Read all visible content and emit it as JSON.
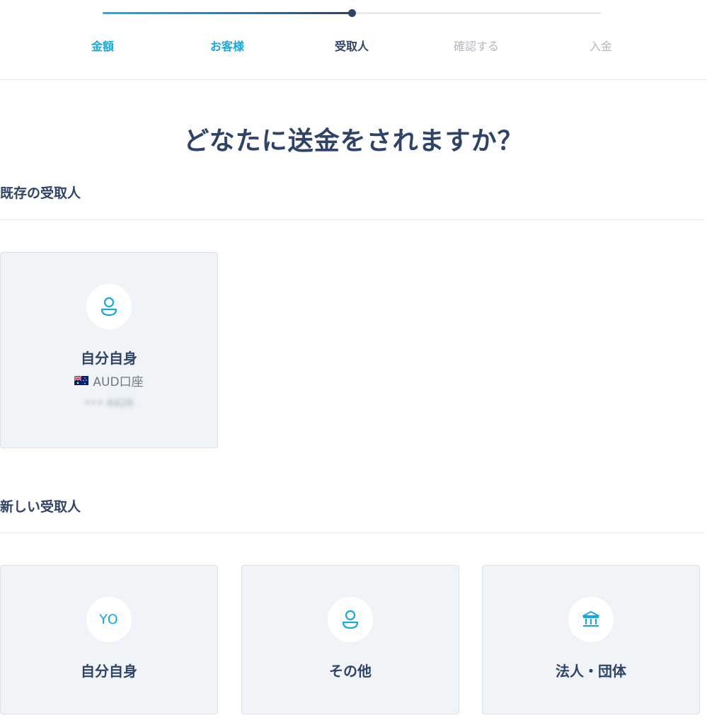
{
  "progress": {
    "value_percent": 50,
    "steps": [
      {
        "label": "金額",
        "state": "done"
      },
      {
        "label": "お客様",
        "state": "done"
      },
      {
        "label": "受取人",
        "state": "current"
      },
      {
        "label": "確認する",
        "state": "todo"
      },
      {
        "label": "入金",
        "state": "todo"
      }
    ]
  },
  "page_title": "どなたに送金をされますか？",
  "existing": {
    "section_title": "既存の受取人",
    "cards": [
      {
        "name": "自分自身",
        "account": "AUD口座",
        "flag": "australia-flag-icon",
        "masked_number": "••• 4426"
      }
    ]
  },
  "new_recipient": {
    "section_title": "新しい受取人",
    "cards": [
      {
        "name": "自分自身",
        "initials": "YO"
      },
      {
        "name": "その他",
        "icon": "person-icon"
      },
      {
        "name": "法人・団体",
        "icon": "bank-icon"
      }
    ]
  },
  "colors": {
    "accent": "#19a8dd",
    "navy": "#2e4369",
    "muted": "#b3b8bf",
    "card_bg": "#f1f4f7"
  }
}
